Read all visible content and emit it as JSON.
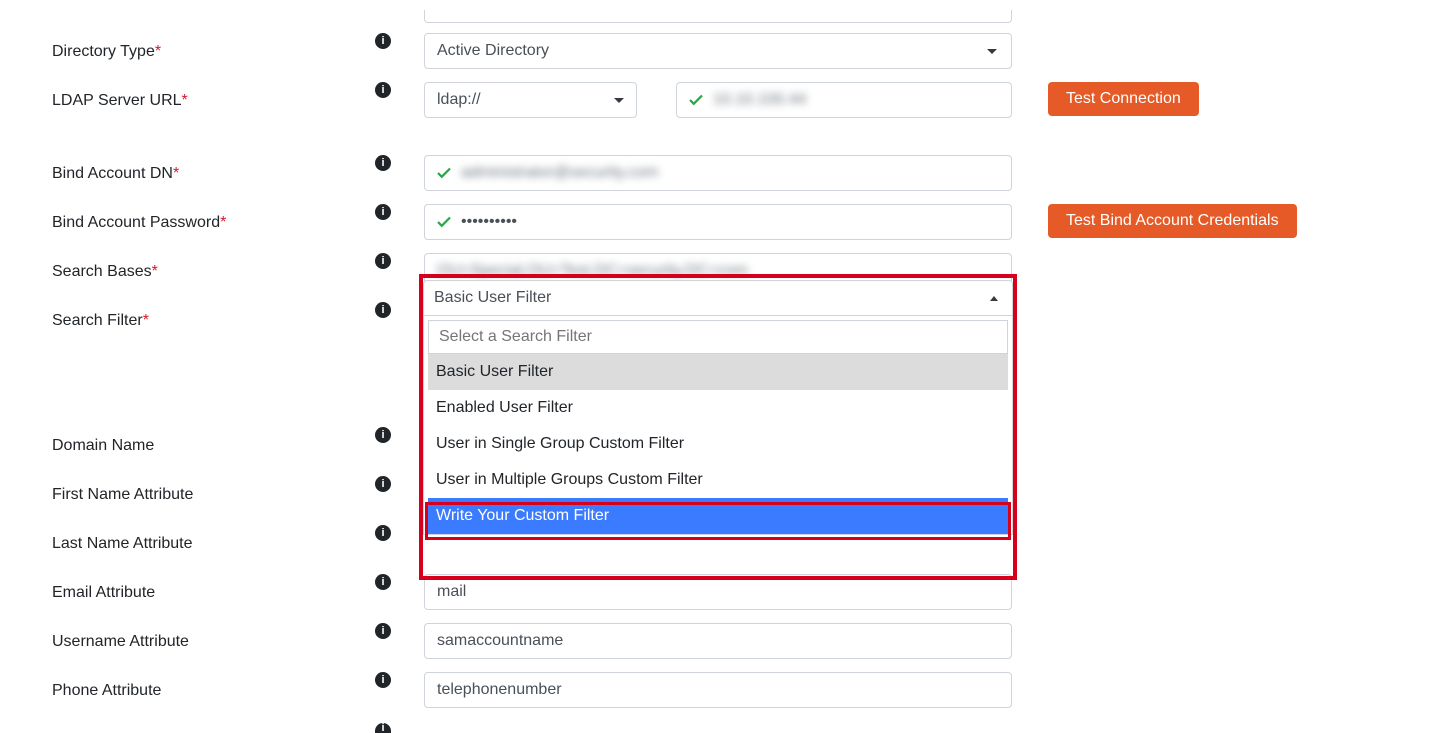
{
  "labels": {
    "directory_type": "Directory Type",
    "ldap_server_url": "LDAP Server URL",
    "bind_account_dn": "Bind Account DN",
    "bind_account_password": "Bind Account Password",
    "search_bases": "Search Bases",
    "search_filter": "Search Filter",
    "domain_name": "Domain Name",
    "first_name_attr": "First Name Attribute",
    "last_name_attr": "Last Name Attribute",
    "email_attr": "Email Attribute",
    "username_attr": "Username Attribute",
    "phone_attr": "Phone Attribute"
  },
  "values": {
    "directory_type": "Active Directory",
    "protocol": "ldap://",
    "server_host": "10.10.100.44",
    "bind_account_dn": "administrator@security.com",
    "bind_account_password": "••••••••••",
    "search_bases": "OU=Special,OU=Test,DC=security,DC=com",
    "email_attr": "mail",
    "username_attr": "samaccountname",
    "phone_attr": "telephonenumber"
  },
  "buttons": {
    "test_connection": "Test Connection",
    "test_bind": "Test Bind Account Credentials"
  },
  "dropdown": {
    "selected": "Basic User Filter",
    "search_placeholder": "Select a Search Filter",
    "options": {
      "opt0": "Basic User Filter",
      "opt1": "Enabled User Filter",
      "opt2": "User in Single Group Custom Filter",
      "opt3": "User in Multiple Groups Custom Filter",
      "opt4": "Write Your Custom Filter"
    }
  }
}
